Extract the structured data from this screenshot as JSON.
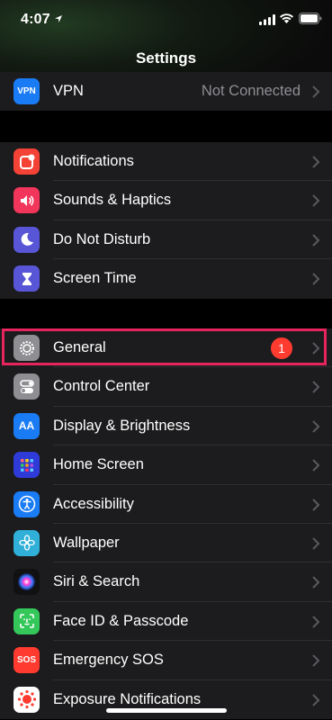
{
  "status_bar": {
    "time": "4:07"
  },
  "nav": {
    "title": "Settings"
  },
  "colors": {
    "vpn": "#1a7cf5",
    "notifications": "#f44336",
    "sounds": "#f2355a",
    "dnd": "#5856d6",
    "screen_time": "#5856d6",
    "general": "#8e8e93",
    "control_center": "#8e8e93",
    "display": "#1a7cf5",
    "home_screen": "#2f3bd9",
    "accessibility": "#1a7cf5",
    "wallpaper": "#30b0d8",
    "siri": "#1c1c1e",
    "face_id": "#34c759",
    "sos": "#ff3b30",
    "exposure": "#ffffff",
    "highlight": "#e6245e",
    "badge": "#ff3b30"
  },
  "rows": {
    "vpn": {
      "icon_text": "VPN",
      "label": "VPN",
      "value": "Not Connected"
    },
    "notifications": {
      "label": "Notifications"
    },
    "sounds": {
      "label": "Sounds & Haptics"
    },
    "dnd": {
      "label": "Do Not Disturb"
    },
    "screen_time": {
      "label": "Screen Time"
    },
    "general": {
      "label": "General",
      "badge": "1"
    },
    "control_center": {
      "label": "Control Center"
    },
    "display": {
      "icon_text": "AA",
      "label": "Display & Brightness"
    },
    "home_screen": {
      "label": "Home Screen"
    },
    "accessibility": {
      "label": "Accessibility"
    },
    "wallpaper": {
      "label": "Wallpaper"
    },
    "siri": {
      "label": "Siri & Search"
    },
    "face_id": {
      "label": "Face ID & Passcode"
    },
    "sos": {
      "icon_text": "SOS",
      "label": "Emergency SOS"
    },
    "exposure": {
      "label": "Exposure Notifications"
    }
  }
}
